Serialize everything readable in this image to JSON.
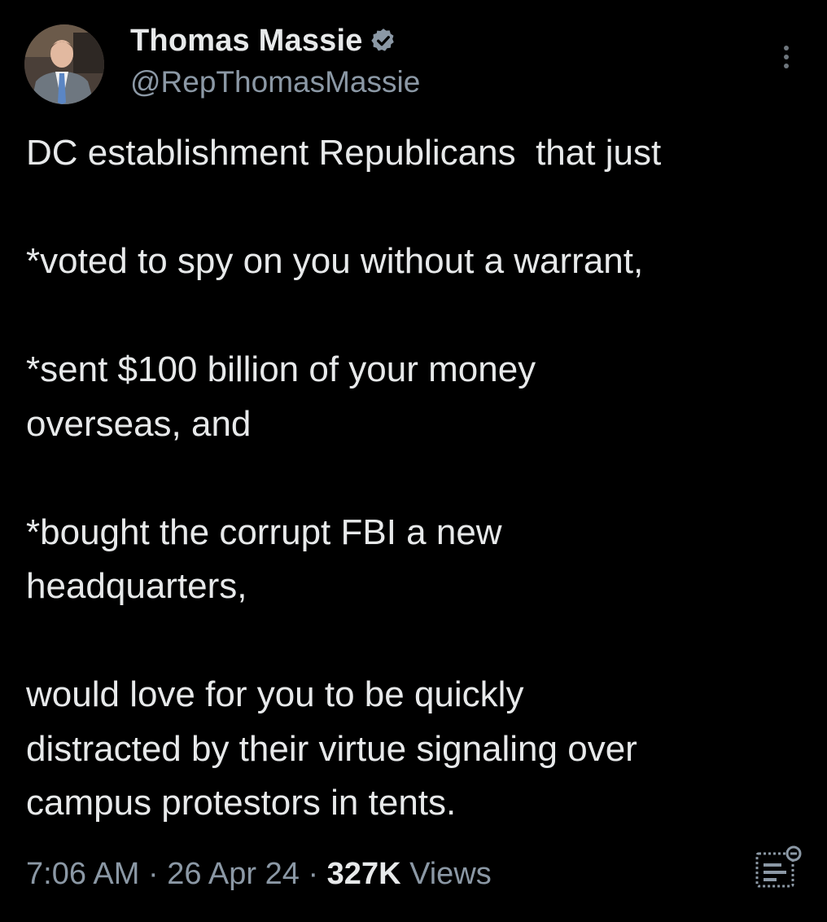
{
  "tweet": {
    "author": {
      "display_name": "Thomas Massie",
      "handle": "@RepThomasMassie",
      "verified": true,
      "verified_color": "#8b98a5"
    },
    "body": [
      "DC establishment Republicans  that just",
      "*voted to spy on you without a warrant,",
      "*sent $100 billion of your money overseas, and",
      "*bought the corrupt FBI a new headquarters,",
      "would love for you to be quickly distracted by their virtue signaling over campus protestors in tents."
    ],
    "body_lines": [
      [
        "DC establishment Republicans  that just"
      ],
      [
        "*voted to spy on you without a warrant,"
      ],
      [
        "*sent $100 billion of your money",
        "overseas, and"
      ],
      [
        "*bought the corrupt FBI a new",
        "headquarters,"
      ],
      [
        "would love for you to be quickly",
        "distracted by their virtue signaling over",
        "campus protestors in tents."
      ]
    ],
    "time": "7:06 AM",
    "separator": "·",
    "date": "26 Apr 24",
    "views_count": "327K",
    "views_label": "Views"
  },
  "icons": {
    "verified": "verified-badge-icon",
    "more": "more-vertical-icon",
    "analytics": "post-analytics-icon",
    "avatar": "profile-photo"
  },
  "colors": {
    "background": "#000000",
    "text_primary": "#e7e9ea",
    "text_secondary": "#8b98a5"
  }
}
